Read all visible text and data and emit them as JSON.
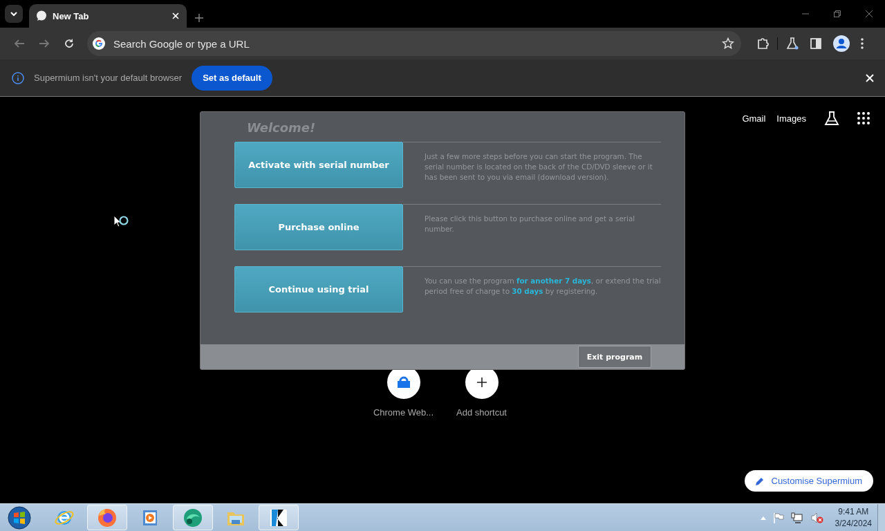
{
  "tab_strip": {
    "tabs": [
      {
        "title": "New Tab",
        "selected": true
      }
    ]
  },
  "omnibox": {
    "placeholder": "Search Google or type a URL"
  },
  "infobar": {
    "message": "Supermium isn't your default browser",
    "button": "Set as default"
  },
  "ntp": {
    "links": [
      "Gmail",
      "Images"
    ],
    "shortcuts": [
      {
        "label": "Chrome Web...",
        "kind": "store"
      },
      {
        "label": "Add shortcut",
        "kind": "add"
      }
    ],
    "customise_button": "Customise Supermium"
  },
  "dialog": {
    "title": "Welcome!",
    "options": [
      {
        "button": "Activate with serial number",
        "description": "Just a few more steps before you can start the program. The serial number is located on the back of the CD/DVD sleeve or it has been sent to you via email (download version)."
      },
      {
        "button": "Purchase online",
        "description": "Please click this button to purchase online and get a serial number."
      },
      {
        "button": "Continue using trial",
        "description": "You can use the program **for another 7 days**, or extend the trial period free of charge to **30 days** by registering."
      }
    ],
    "exit_button": "Exit program"
  },
  "taskbar": {
    "apps": [
      {
        "kind": "browser-e",
        "running": false
      },
      {
        "kind": "firefox",
        "running": true
      },
      {
        "kind": "player",
        "running": false
      },
      {
        "kind": "green",
        "running": true
      },
      {
        "kind": "folder",
        "running": false
      },
      {
        "kind": "video-editor",
        "running": true
      }
    ],
    "clock": {
      "time": "9:41 AM",
      "date": "3/24/2024"
    }
  }
}
